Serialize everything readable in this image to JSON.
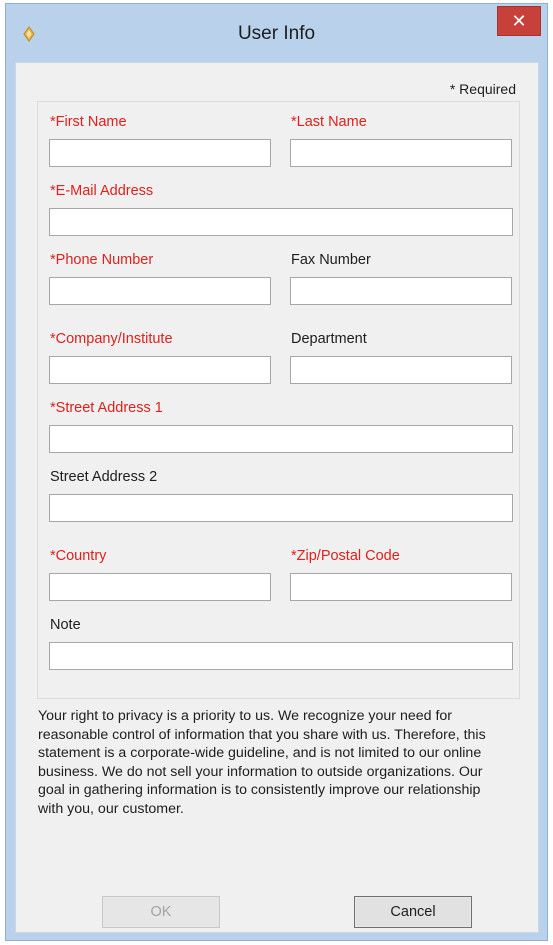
{
  "window": {
    "title": "User Info",
    "close_glyph": "✕",
    "icon": "pencil-icon"
  },
  "form": {
    "required_note": "* Required",
    "first_name": {
      "label": "*First Name",
      "value": "",
      "required": true
    },
    "last_name": {
      "label": "*Last Name",
      "value": "",
      "required": true
    },
    "email": {
      "label": "*E-Mail Address",
      "value": "",
      "required": true
    },
    "phone": {
      "label": "*Phone Number",
      "value": "",
      "required": true
    },
    "fax": {
      "label": "Fax Number",
      "value": "",
      "required": false
    },
    "company": {
      "label": "*Company/Institute",
      "value": "",
      "required": true
    },
    "department": {
      "label": "Department",
      "value": "",
      "required": false
    },
    "street1": {
      "label": "*Street Address 1",
      "value": "",
      "required": true
    },
    "street2": {
      "label": "Street Address 2",
      "value": "",
      "required": false
    },
    "country": {
      "label": "*Country",
      "value": "",
      "required": true
    },
    "zip": {
      "label": "*Zip/Postal Code",
      "value": "",
      "required": true
    },
    "note": {
      "label": "Note",
      "value": "",
      "required": false
    }
  },
  "privacy_text": "Your right to privacy is a priority to us. We recognize your need for reasonable control of information that you share with us. Therefore, this statement is a corporate-wide guideline, and is not limited to our online business. We do not sell your information to outside organizations. Our goal in gathering information is to consistently improve our relationship with you, our customer.",
  "buttons": {
    "ok": "OK",
    "cancel": "Cancel"
  },
  "colors": {
    "required_label": "#e0211d",
    "window_frame": "#b9d1ea",
    "close_button": "#c7413a",
    "dialog_background": "#f0f0f0"
  }
}
